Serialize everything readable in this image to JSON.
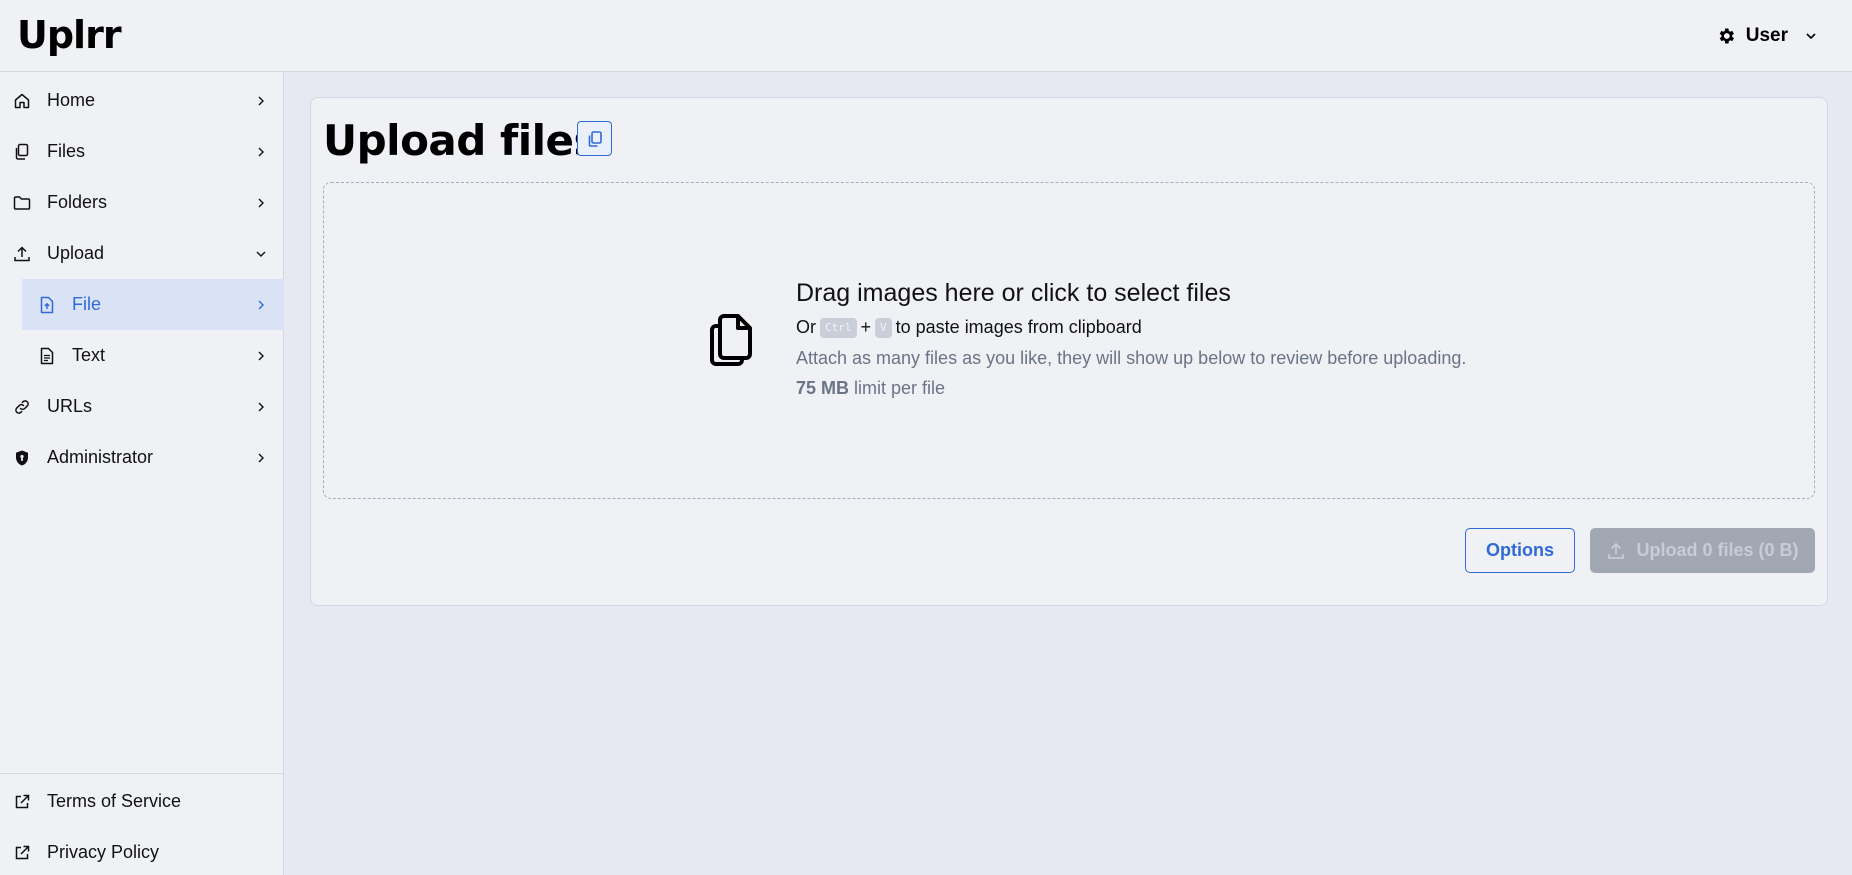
{
  "app": {
    "title": "Uplrr"
  },
  "user_menu": {
    "label": "User"
  },
  "sidebar": {
    "items": [
      {
        "label": "Home",
        "icon": "home-icon"
      },
      {
        "label": "Files",
        "icon": "files-icon"
      },
      {
        "label": "Folders",
        "icon": "folder-icon"
      },
      {
        "label": "Upload",
        "icon": "upload-icon",
        "expanded": true
      },
      {
        "label": "File",
        "icon": "file-upload-icon",
        "active": true
      },
      {
        "label": "Text",
        "icon": "file-text-icon"
      },
      {
        "label": "URLs",
        "icon": "link-icon"
      },
      {
        "label": "Administrator",
        "icon": "shield-icon"
      }
    ],
    "footer": [
      {
        "label": "Terms of Service",
        "icon": "external-link-icon"
      },
      {
        "label": "Privacy Policy",
        "icon": "external-link-icon"
      }
    ]
  },
  "main": {
    "title": "Upload files",
    "dropzone": {
      "title": "Drag images here or click to select files",
      "paste_prefix": "Or",
      "key_ctrl": "Ctrl",
      "key_plus": "+",
      "key_v": "V",
      "paste_suffix": "to paste images from clipboard",
      "attach": "Attach as many files as you like, they will show up below to review before uploading.",
      "limit_value": "75 MB",
      "limit_suffix": "limit per file"
    },
    "options_label": "Options",
    "upload_label": "Upload 0 files (0 B)"
  },
  "colors": {
    "accent": "#2f6ad6",
    "active_bg": "#d9e3f5",
    "disabled_button": "#a2a7b4"
  }
}
